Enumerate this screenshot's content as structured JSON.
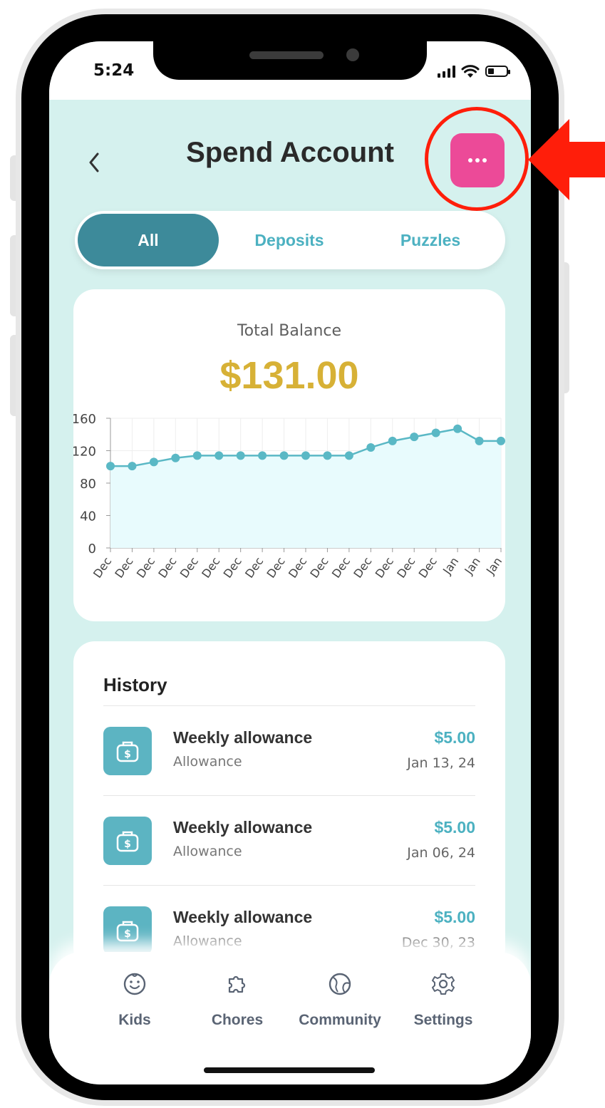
{
  "status_bar": {
    "time": "5:24"
  },
  "header": {
    "title": "Spend Account",
    "back_icon": "chevron-left-icon",
    "more_icon": "more-horizontal-icon"
  },
  "tabs": [
    {
      "label": "All",
      "active": true
    },
    {
      "label": "Deposits",
      "active": false
    },
    {
      "label": "Puzzles",
      "active": false
    }
  ],
  "balance": {
    "label": "Total Balance",
    "value": "$131.00"
  },
  "chart_data": {
    "type": "area",
    "x": [
      "Dec",
      "Dec",
      "Dec",
      "Dec",
      "Dec",
      "Dec",
      "Dec",
      "Dec",
      "Dec",
      "Dec",
      "Dec",
      "Dec",
      "Dec",
      "Dec",
      "Dec",
      "Dec",
      "Jan",
      "Jan",
      "Jan"
    ],
    "values": [
      101,
      101,
      106,
      111,
      114,
      114,
      114,
      114,
      114,
      114,
      114,
      114,
      124,
      132,
      137,
      142,
      147,
      132
    ],
    "yticks": [
      0,
      40,
      80,
      120,
      160
    ],
    "ylim": [
      0,
      160
    ],
    "grid": true,
    "colors": {
      "line": "#5ab8c5",
      "fill": "#e8fbfd",
      "point": "#5ab8c5"
    }
  },
  "history": {
    "title": "History",
    "items": [
      {
        "title": "Weekly allowance",
        "subtitle": "Allowance",
        "amount": "$5.00",
        "date": "Jan 13, 24",
        "icon": "money-bag-icon"
      },
      {
        "title": "Weekly allowance",
        "subtitle": "Allowance",
        "amount": "$5.00",
        "date": "Jan 06, 24",
        "icon": "money-bag-icon"
      },
      {
        "title": "Weekly allowance",
        "subtitle": "Allowance",
        "amount": "$5.00",
        "date": "Dec 30, 23",
        "icon": "money-bag-icon"
      }
    ]
  },
  "bottom_nav": [
    {
      "label": "Kids",
      "icon": "smiley-face-icon"
    },
    {
      "label": "Chores",
      "icon": "puzzle-piece-icon"
    },
    {
      "label": "Community",
      "icon": "globe-icon"
    },
    {
      "label": "Settings",
      "icon": "gear-icon"
    }
  ],
  "colors": {
    "screen_bg": "#d5f1ee",
    "accent_teal": "#4cb1c1",
    "active_tab": "#3d8a9a",
    "balance_gold": "#d7b136",
    "more_button": "#ec4a98",
    "annotation_red": "#ff1e0a"
  }
}
